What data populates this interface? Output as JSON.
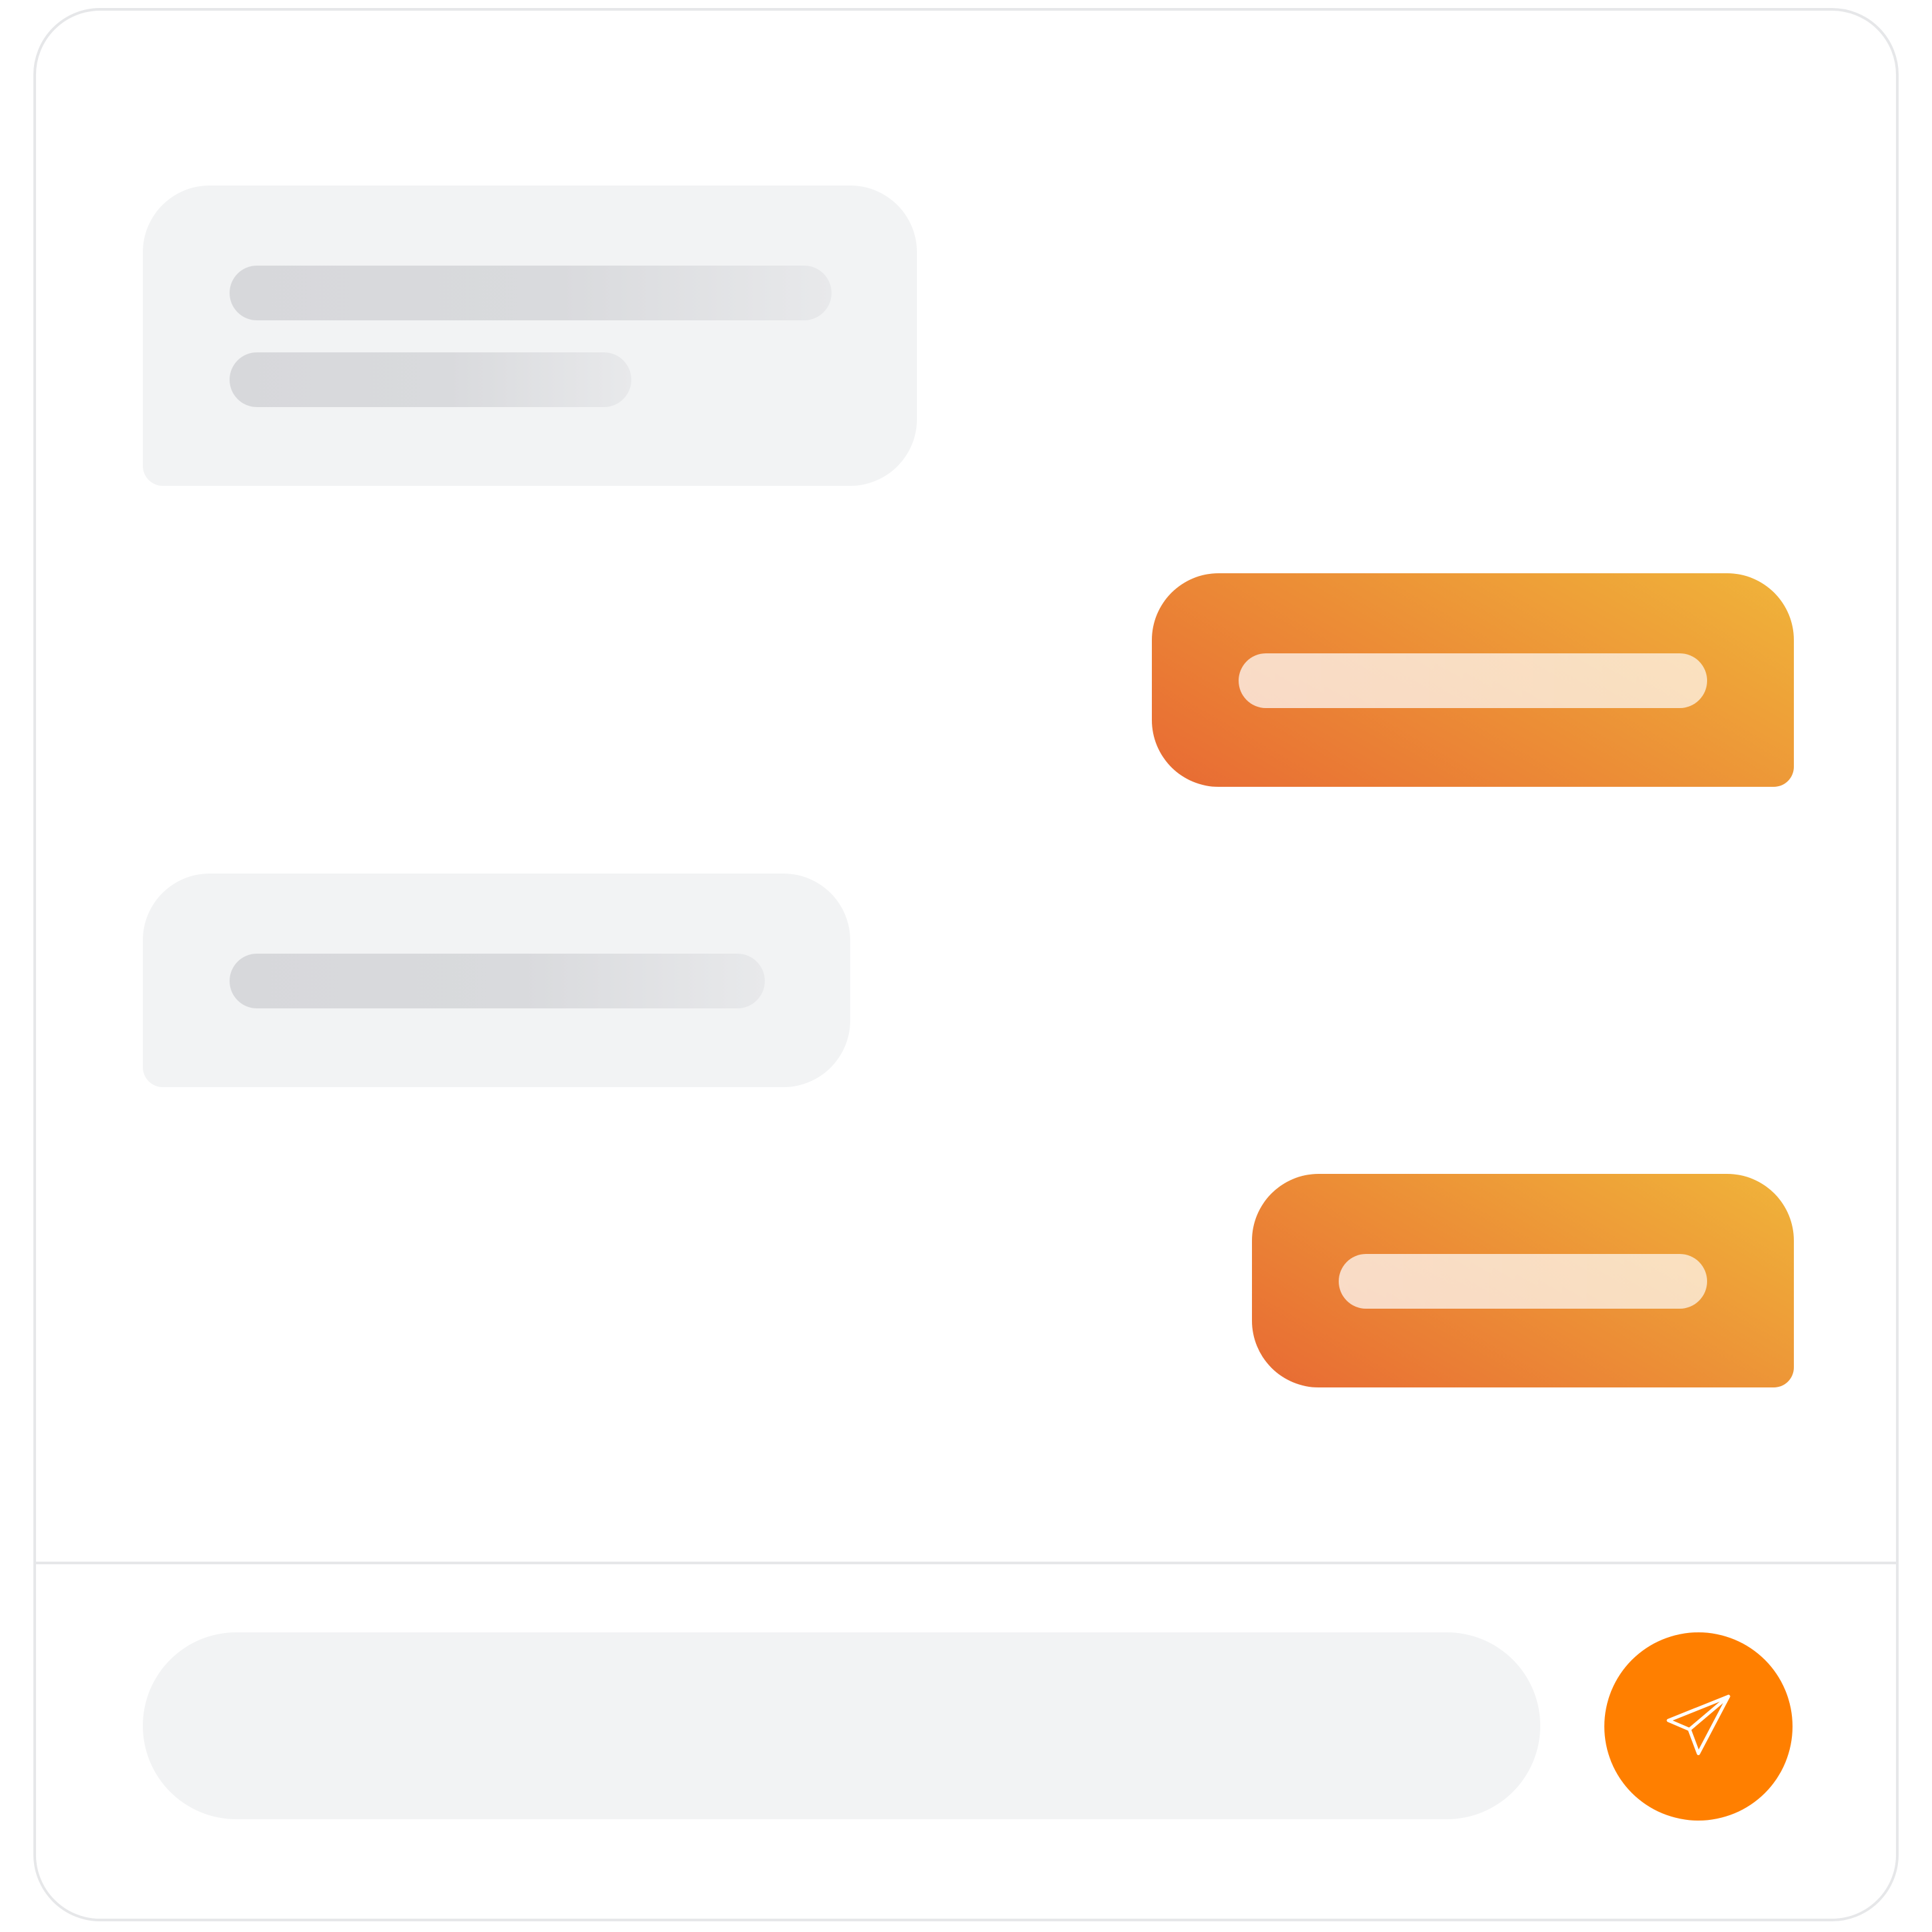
{
  "theme": {
    "accent": "#FF7F00",
    "outgoing_gradient_start": "#E86A33",
    "outgoing_gradient_end": "#F0B43A",
    "incoming_bubble": "#F2F3F4",
    "placeholder_line": "#D7D8DB",
    "border": "#E6E7E9"
  },
  "conversation": {
    "messages": [
      {
        "sender": "incoming",
        "text": "",
        "line_count": 2
      },
      {
        "sender": "outgoing",
        "text": "",
        "line_count": 1
      },
      {
        "sender": "incoming",
        "text": "",
        "line_count": 1
      },
      {
        "sender": "outgoing",
        "text": "",
        "line_count": 1
      }
    ]
  },
  "composer": {
    "input_value": "",
    "placeholder": "",
    "send_icon": "paper-plane-icon"
  }
}
